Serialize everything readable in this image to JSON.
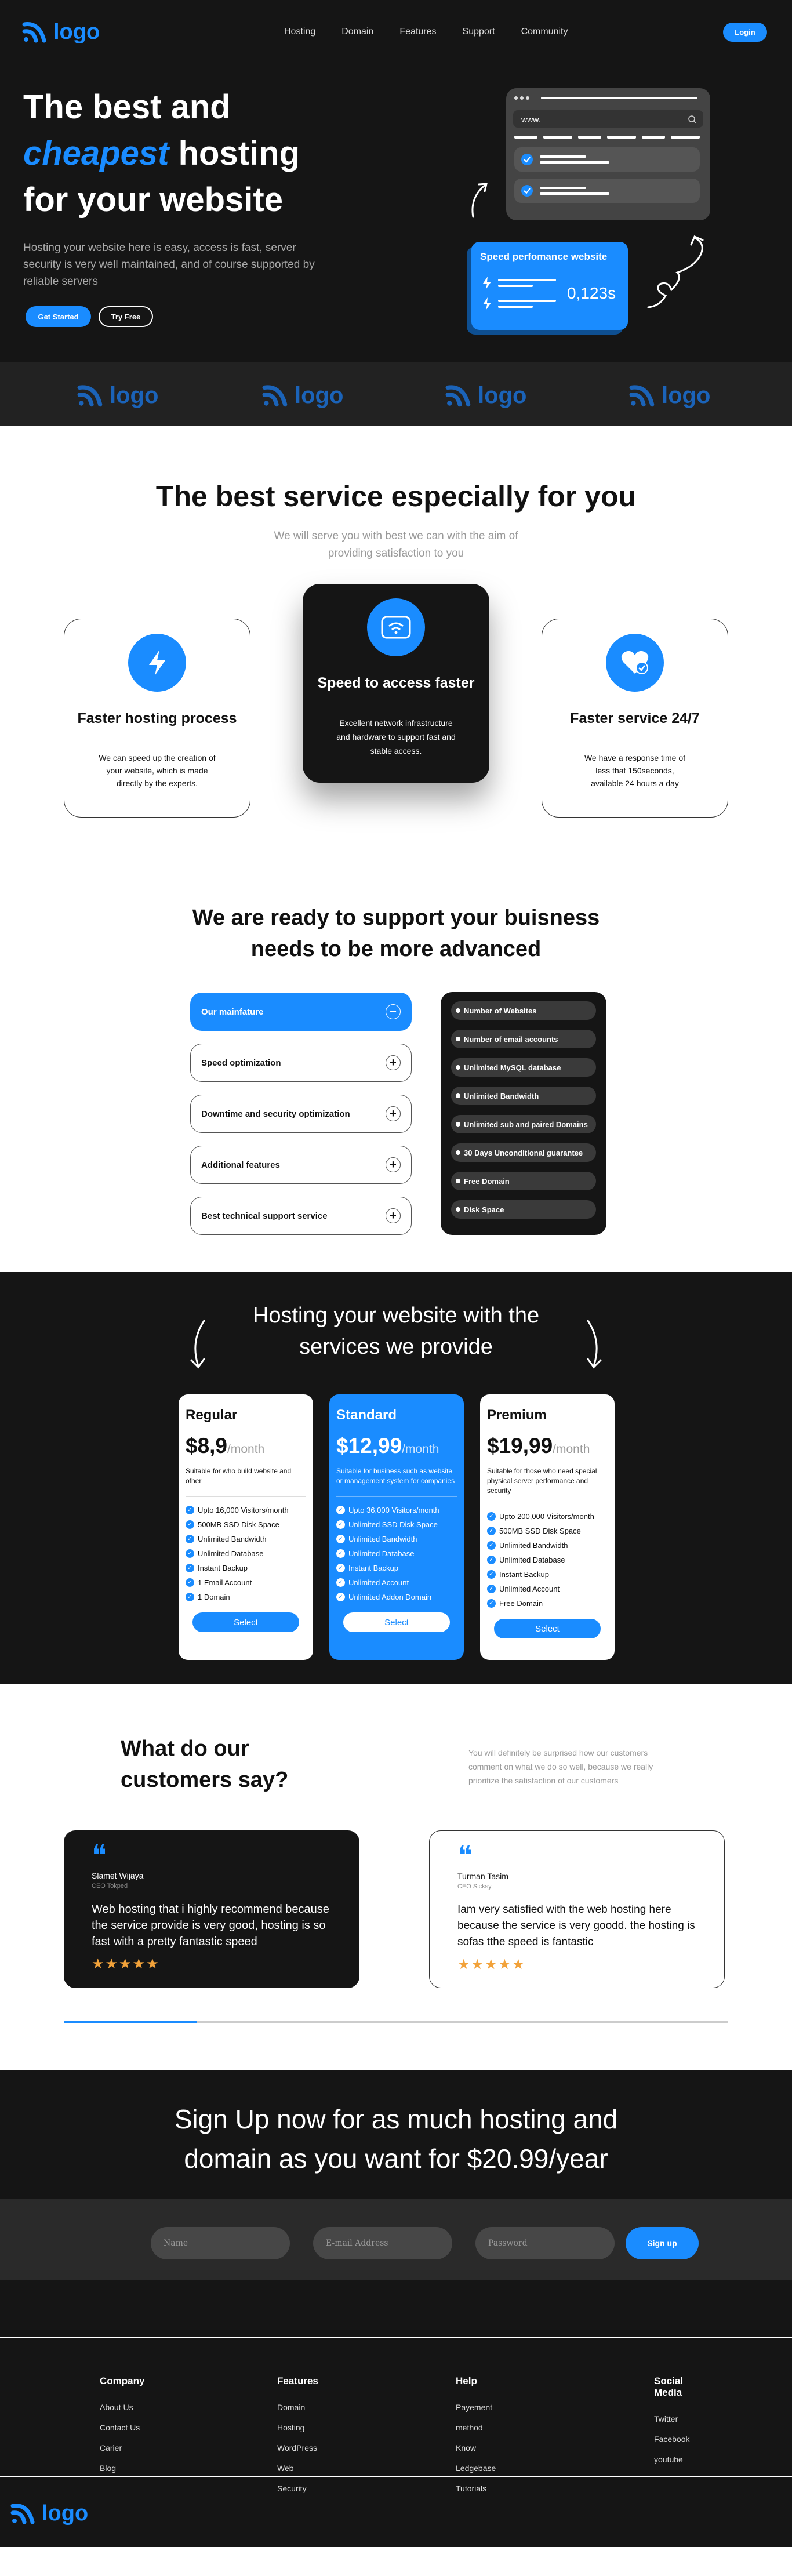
{
  "nav": {
    "logo": "logo",
    "links": [
      "Hosting",
      "Domain",
      "Features",
      "Support",
      "Community"
    ],
    "login": "Login"
  },
  "hero": {
    "title_1": "The best and",
    "title_2": "cheapest",
    "title_3": "hosting",
    "title_4": "for your website",
    "subtitle": "Hosting your website here is easy, access is fast, server security is very well maintained, and of course supported by reliable servers",
    "get_started": "Get Started",
    "try_free": "Try Free",
    "browser_url": "www.",
    "speed_title": "Speed perfomance website",
    "speed_value": "0,123s"
  },
  "logo_strip": [
    "logo",
    "logo",
    "logo",
    "logo"
  ],
  "services": {
    "title": "The best service especially for you",
    "subtitle": "We will serve you with best we can with the aim of providing satisfaction to you",
    "cards": [
      {
        "title": "Faster hosting process",
        "text": "We can speed up the creation of your website, which is made directly by the experts."
      },
      {
        "title": "Speed to access faster",
        "text": "Excellent network infrastructure and hardware to support fast and stable access."
      },
      {
        "title": "Faster service 24/7",
        "text": "We have a response time of less that 150seconds, available 24 hours a day"
      }
    ]
  },
  "support": {
    "title_1": "We are ready to support your buisness",
    "title_2": "needs to be more advanced",
    "accordion": [
      "Our mainfature",
      "Speed optimization",
      "Downtime and security optimization",
      "Additional features",
      "Best technical support service"
    ],
    "features": [
      "Number of Websites",
      "Number of email accounts",
      "Unlimited MySQL database",
      "Unlimited Bandwidth",
      "Unlimited sub and paired Domains",
      "30 Days Unconditional guarantee",
      "Free Domain",
      "Disk Space"
    ]
  },
  "pricing": {
    "title_1": "Hosting your website with the",
    "title_2": "services we provide",
    "plans": [
      {
        "name": "Regular",
        "price": "$8,9",
        "period": "/month",
        "desc": "Suitable for who build website and other",
        "features": [
          "Upto 16,000 Visitors/month",
          "500MB SSD Disk Space",
          "Unlimited Bandwidth",
          "Unlimited Database",
          "Instant Backup",
          "1 Email Account",
          "1 Domain"
        ],
        "button": "Select"
      },
      {
        "name": "Standard",
        "price": "$12,99",
        "period": "/month",
        "desc": "Suitable for business such as website or management system for companies",
        "features": [
          "Upto 36,000 Visitors/month",
          "Unlimited SSD Disk Space",
          "Unlimited Bandwidth",
          "Unlimited Database",
          "Instant Backup",
          "Unlimited Account",
          "Unlimited Addon Domain"
        ],
        "button": "Select"
      },
      {
        "name": "Premium",
        "price": "$19,99",
        "period": "/month",
        "desc": "Suitable for those who need special physical server performance and security",
        "features": [
          "Upto 200,000 Visitors/month",
          "500MB SSD Disk Space",
          "Unlimited Bandwidth",
          "Unlimited Database",
          "Instant Backup",
          "Unlimited Account",
          "Free Domain"
        ],
        "button": "Select"
      }
    ]
  },
  "testimonials": {
    "title_1": "What do our",
    "title_2": "customers say?",
    "subtitle": "You will definitely be surprised how our customers comment on what we do so well, because we really prioritize the satisfaction of our customers",
    "items": [
      {
        "name": "Slamet Wijaya",
        "role": "CEO Tokped",
        "text": "Web hosting that i highly recommend because the service provide is very good, hosting is so fast with a pretty fantastic speed",
        "stars": "★★★★★"
      },
      {
        "name": "Turman Tasim",
        "role": "CEO Sicksy",
        "text": "Iam very satisfied with the web hosting here because the service is very goodd. the hosting is sofas tthe speed is fantastic",
        "stars": "★★★★★"
      }
    ],
    "progress": 0.2
  },
  "signup": {
    "title_1": "Sign Up now for as much hosting and",
    "title_2": "domain as you want for $20.99/year",
    "name_placeholder": "Name",
    "email_placeholder": "E-mail Address",
    "password_placeholder": "Password",
    "button": "Sign up"
  },
  "footer": {
    "columns": [
      {
        "title": "Company",
        "links": [
          "About Us",
          "Contact Us",
          "Carier",
          "Blog"
        ]
      },
      {
        "title": "Features",
        "links": [
          "Domain",
          "Hosting",
          "WordPress",
          "Web Security"
        ]
      },
      {
        "title": "Help",
        "links": [
          "Payement method",
          "Know Ledgebase",
          "Tutorials"
        ]
      },
      {
        "title": "Social Media",
        "links": [
          "Twitter",
          "Facebook",
          "youtube"
        ]
      }
    ],
    "logo": "logo"
  },
  "colors": {
    "accent": "#1a8cff",
    "dark": "#151515",
    "strip": "#222222"
  }
}
